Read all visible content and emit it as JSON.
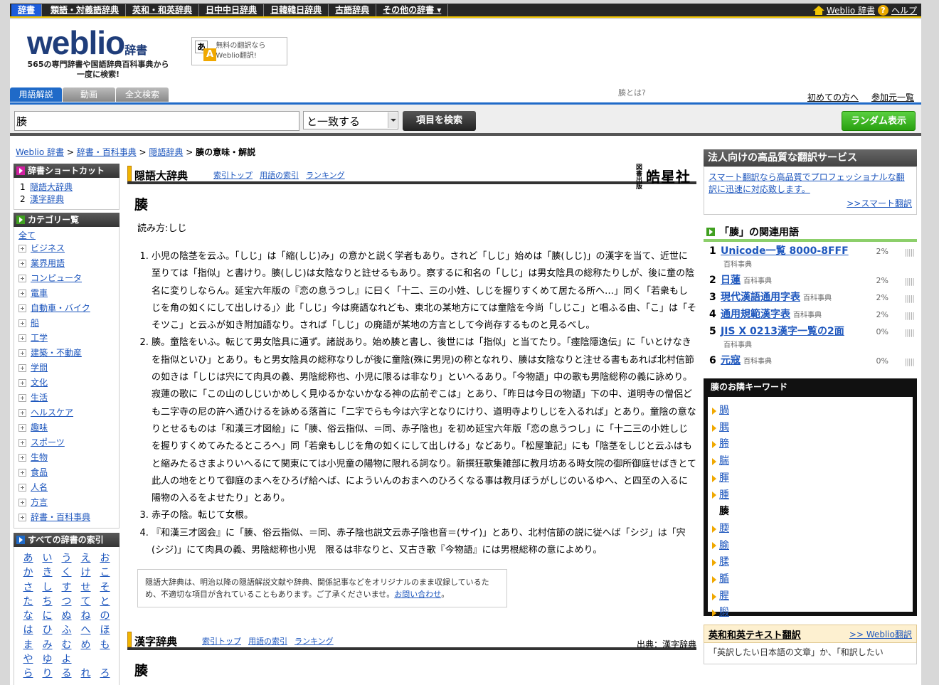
{
  "topbar": {
    "nav": [
      "辞書",
      "類語・対義語辞典",
      "英和・和英辞典",
      "日中中日辞典",
      "日韓韓日辞典",
      "古語辞典",
      "その他の辞書 ▾"
    ],
    "home_label": "Weblio 辞書",
    "help_label": "ヘルプ"
  },
  "header": {
    "logo_word": "weblio",
    "logo_sub": "辞書",
    "tagline": "565の専門辞書や国語辞典百科事典から一度に検索!",
    "trans_glyph_1": "あ",
    "trans_glyph_2": "A",
    "trans_text": "無料の翻訳ならWeblio翻訳!",
    "tabs": [
      "用語解説",
      "動画",
      "全文検索"
    ],
    "what_is": "腠とは?",
    "links": [
      "初めての方へ",
      "参加元一覧"
    ]
  },
  "search": {
    "value": "腠",
    "match": "と一致する",
    "button": "項目を検索",
    "random": "ランダム表示"
  },
  "breadcrumb": {
    "items": [
      "Weblio 辞書",
      "辞書・百科事典",
      "隠語辞典"
    ],
    "sep": " > ",
    "current": "腠の意味・解説"
  },
  "left": {
    "shortcut_title": "辞書ショートカット",
    "shortcuts": [
      {
        "n": "1",
        "label": "隠語大辞典"
      },
      {
        "n": "2",
        "label": "漢字辞典"
      }
    ],
    "category_title": "カテゴリー覧",
    "all": "全て",
    "categories": [
      "ビジネス",
      "業界用語",
      "コンピュータ",
      "電車",
      "自動車・バイク",
      "船",
      "工学",
      "建築・不動産",
      "学問",
      "文化",
      "生活",
      "ヘルスケア",
      "趣味",
      "スポーツ",
      "生物",
      "食品",
      "人名",
      "方言",
      "辞書・百科事典"
    ],
    "index_title": "すべての辞書の索引",
    "kana": [
      "あ",
      "い",
      "う",
      "え",
      "お",
      "か",
      "き",
      "く",
      "け",
      "こ",
      "さ",
      "し",
      "す",
      "せ",
      "そ",
      "た",
      "ち",
      "つ",
      "て",
      "と",
      "な",
      "に",
      "ぬ",
      "ね",
      "の",
      "は",
      "ひ",
      "ふ",
      "へ",
      "ほ",
      "ま",
      "み",
      "む",
      "め",
      "も",
      "や",
      "ゆ",
      "よ",
      "",
      "",
      "ら",
      "り",
      "る",
      "れ",
      "ろ"
    ]
  },
  "main": {
    "dict1": {
      "name": "隠語大辞典",
      "links": [
        "索引トップ",
        "用語の索引",
        "ランキング"
      ],
      "publisher_small": "図書出版",
      "publisher": "皓星社",
      "headword": "腠",
      "reading": "読み方:しじ",
      "entries": [
        "小児の陰茎を云ふ。「しじ」は「縮(しじ)み」の意かと説く学者もあり。されど「しじ」始めは「腠(しじ)」の漢字を当て、近世に至りては「指似」と書けり。腠(しじ)は女陰なりと註せるもあり。察するに和名の「しじ」は男女陰具の総称たりしが、後に童の陰名に変りしならん。延宝六年版の『恋の息うつし』に曰く「十二、三の小姓、しじを握りすくめて居たる所へ…」同く「若衆もしじを角の如くにして出しける」〉此「しじ」今は廃語なれども、東北の某地方にては童陰を今尚「しじこ」と唱ふる由、「こ」は「そそツこ」と云ふが如き附加語なり。されば「しじ」の廃語が某地の方言として今尚存するものと見るべし。",
        "腠。童陰をいふ。転じて男女陰具に通ず。諸説あり。始め腠と書し、後世には「指似」と当てたり。「瘞陰隱逸伝」に「いとけなきを指似といひ」とあり。もと男女陰具の総称なりしが後に童陰(殊に男児)の称となれり、腠は女陰なりと注せる書もあれば北村信節の如きは「しじは宍にて肉具の義、男陰総称也、小児に限るは非なり」といへるあり。「今物語」中の歌も男陰総称の義に詠めり。寂蓮の歌に「この山のしじいかめしく見ゆるかないかなる神の広前ぞこは」とあり、「昨日は今日の物語」下の中、道明寺の僧侶ども二字寺の尼の許へ通ひけるを詠める落首に「二字でらも今は六字となりにけり、道明寺よりしじを入るれば」とあり。童陰の意なりとせるものは「和漢三才図絵」に「腠、俗云指似、＝同、赤子陰也」を初め延宝六年版「恋の息うつし」に「十二三の小姓しじを握りすくめてみたるところへ」同「若衆もしじを角の如くにして出しける」などあり。「松屋筆記」にも「陰茎をしじと云ふはもと縮みたるさまよりいへるにて関東にては小児童の陽物に限れる詞なり。新撰狂歌集雑部に教月坊ある時女院の御所御庭せばきとて此人の地をとりて御庭のまへをひろげ給へば、によういんのおまへのひろくなる事は教月ぼうがしじのいるゆへ、と四至の入るに陽物の入るをよせたり」とあり。",
        "赤子の陰。転じて女根。",
        "『和漢三才図会』に「腠、俗云指似、＝同、赤子陰也説文云赤子陰也音＝(サイ)」とあり、北村信節の説に従へば「シジ」は「宍(シジ)」にて肉具の義、男陰総称也小児　限るは非なりと、又古き歌『今物語』には男根総称の意によめり。"
      ],
      "note": "隠語大辞典は、明治以降の隠語解説文献や辞典、関係記事などをオリジナルのまま収録しているため、不適切な項目が含れていることもあります。ご了承くださいませ。",
      "note_link": "お問い合わせ",
      "note_end": "。"
    },
    "dict2": {
      "name": "漢字辞典",
      "links": [
        "索引トップ",
        "用語の索引",
        "ランキング"
      ],
      "source": "出典：漢字辞典",
      "headword": "腠"
    }
  },
  "right": {
    "pro_title": "法人向けの高品質な翻訳サービス",
    "pro_text": "スマート翻訳なら高品質でプロフェッショナルな翻訳に迅速に対応致します。",
    "pro_link": ">>スマート翻訳",
    "related_title": "「腠」の関連用語",
    "related": [
      {
        "rank": "1",
        "term": "Unicode一覧 8000-8FFF",
        "cat": "百科事典",
        "pct": "2%"
      },
      {
        "rank": "2",
        "term": "日蓮",
        "cat": "百科事典",
        "pct": "2%"
      },
      {
        "rank": "3",
        "term": "現代漢語通用字表",
        "cat": "百科事典",
        "pct": "2%"
      },
      {
        "rank": "4",
        "term": "通用規範漢字表",
        "cat": "百科事典",
        "pct": "2%"
      },
      {
        "rank": "5",
        "term": "JIS X 0213漢字一覧の2面",
        "cat": "百科事典",
        "pct": "0%"
      },
      {
        "rank": "6",
        "term": "元寇",
        "cat": "百科事典",
        "pct": "0%"
      }
    ],
    "bars": "|||||",
    "neighbors_title": "腠のお隣キーワード",
    "neighbors": [
      "腡",
      "腢",
      "腣",
      "腨",
      "腪",
      "腫",
      "腠",
      "腝",
      "腧",
      "腬",
      "腯",
      "腥",
      "腶"
    ],
    "neighbors_current_index": 6,
    "trans_title": "英和和英テキスト翻訳",
    "trans_link": ">> Weblio翻訳",
    "trans_placeholder": "「英訳したい日本語の文章」か、「和訳したい"
  }
}
